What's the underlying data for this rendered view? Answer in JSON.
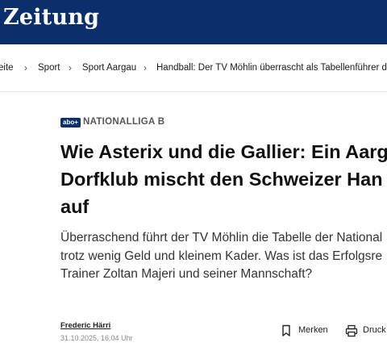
{
  "header": {
    "brand": "Zeitung"
  },
  "breadcrumb": {
    "items": [
      "eite",
      "Sport",
      "Sport Aargau",
      "Handball: Der TV Möhlin überrascht als Tabellenführer der"
    ]
  },
  "article": {
    "abo_badge": "abo+",
    "kicker": "NATIONALLIGA B",
    "headline_lines": [
      "Wie Asterix und die Gallier: Ein Aarg",
      "Dorfklub mischt den Schweizer Han",
      "auf"
    ],
    "lead_lines": [
      "Überraschend führt der TV Möhlin die Tabelle der National",
      "trotz wenig Geld und kleinem Kader. Was ist das Erfolgsre",
      "Trainer Zoltan Majeri und seiner Mannschaft?"
    ],
    "author": "Frederic Härri",
    "date": "31.10.2025, 16.04 Uhr"
  },
  "actions": {
    "bookmark_label": "Merken",
    "print_label": "Druck"
  },
  "colors": {
    "masthead": "#0b2f6b",
    "text": "#1a1a1a"
  }
}
